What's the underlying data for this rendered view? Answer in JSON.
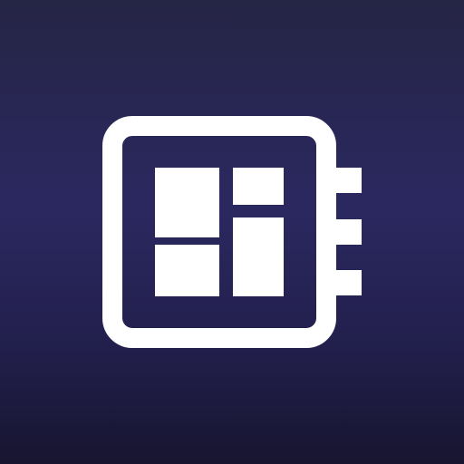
{
  "icon": {
    "name": "chip-grid-icon",
    "colors": {
      "background_top": "#252545",
      "background_mid": "#2b2860",
      "background_bottom": "#17152f",
      "glyph": "#ffffff"
    }
  }
}
